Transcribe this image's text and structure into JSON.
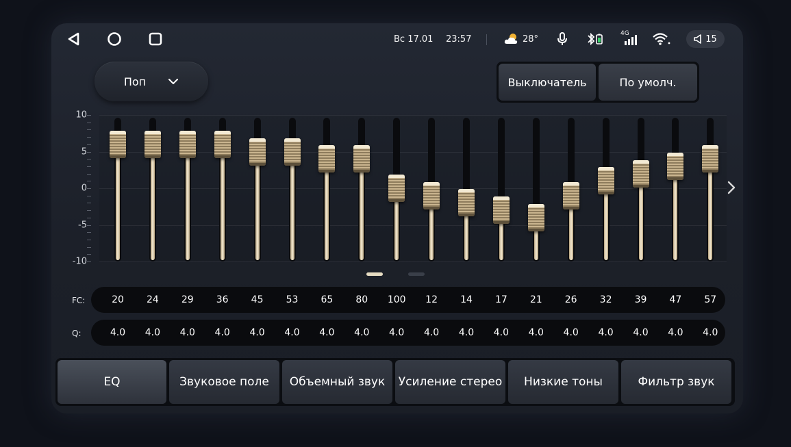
{
  "status_bar": {
    "date": "Вс 17.01",
    "time": "23:57",
    "temperature": "28°",
    "signal_label": "4G",
    "volume": "15",
    "icons": [
      "back-icon",
      "home-icon",
      "recents-icon",
      "weather-sun-cloud-icon",
      "microphone-icon",
      "bluetooth-battery-icon",
      "cellular-signal-icon",
      "wifi-icon",
      "volume-icon"
    ]
  },
  "preset": {
    "label": "Поп"
  },
  "buttons": {
    "switch_label": "Выключатель",
    "default_label": "По умолч."
  },
  "eq": {
    "y_ticks": [
      "10",
      "5",
      "0",
      "-5",
      "-10"
    ],
    "y_range": [
      -10,
      10
    ],
    "bands": [
      {
        "fc": "20",
        "q": "4.0",
        "gain": 6
      },
      {
        "fc": "24",
        "q": "4.0",
        "gain": 6
      },
      {
        "fc": "29",
        "q": "4.0",
        "gain": 6
      },
      {
        "fc": "36",
        "q": "4.0",
        "gain": 6
      },
      {
        "fc": "45",
        "q": "4.0",
        "gain": 5
      },
      {
        "fc": "53",
        "q": "4.0",
        "gain": 5
      },
      {
        "fc": "65",
        "q": "4.0",
        "gain": 4
      },
      {
        "fc": "80",
        "q": "4.0",
        "gain": 4
      },
      {
        "fc": "100",
        "q": "4.0",
        "gain": 0
      },
      {
        "fc": "12",
        "q": "4.0",
        "gain": -1
      },
      {
        "fc": "14",
        "q": "4.0",
        "gain": -2
      },
      {
        "fc": "17",
        "q": "4.0",
        "gain": -3
      },
      {
        "fc": "21",
        "q": "4.0",
        "gain": -4
      },
      {
        "fc": "26",
        "q": "4.0",
        "gain": -1
      },
      {
        "fc": "32",
        "q": "4.0",
        "gain": 1
      },
      {
        "fc": "39",
        "q": "4.0",
        "gain": 2
      },
      {
        "fc": "47",
        "q": "4.0",
        "gain": 3
      },
      {
        "fc": "57",
        "q": "4.0",
        "gain": 4
      }
    ]
  },
  "labels": {
    "fc": "FC:",
    "q": "Q:"
  },
  "tabs": [
    {
      "label": "EQ",
      "active": true
    },
    {
      "label": "Звуковое поле"
    },
    {
      "label": "Объемный звук"
    },
    {
      "label": "Усиление стерео"
    },
    {
      "label": "Низкие тоны"
    },
    {
      "label": "Фильтр звук"
    }
  ],
  "colors": {
    "accent": "#e6dcc2",
    "track": "#0a0b0e",
    "panel": "#1e222a"
  }
}
